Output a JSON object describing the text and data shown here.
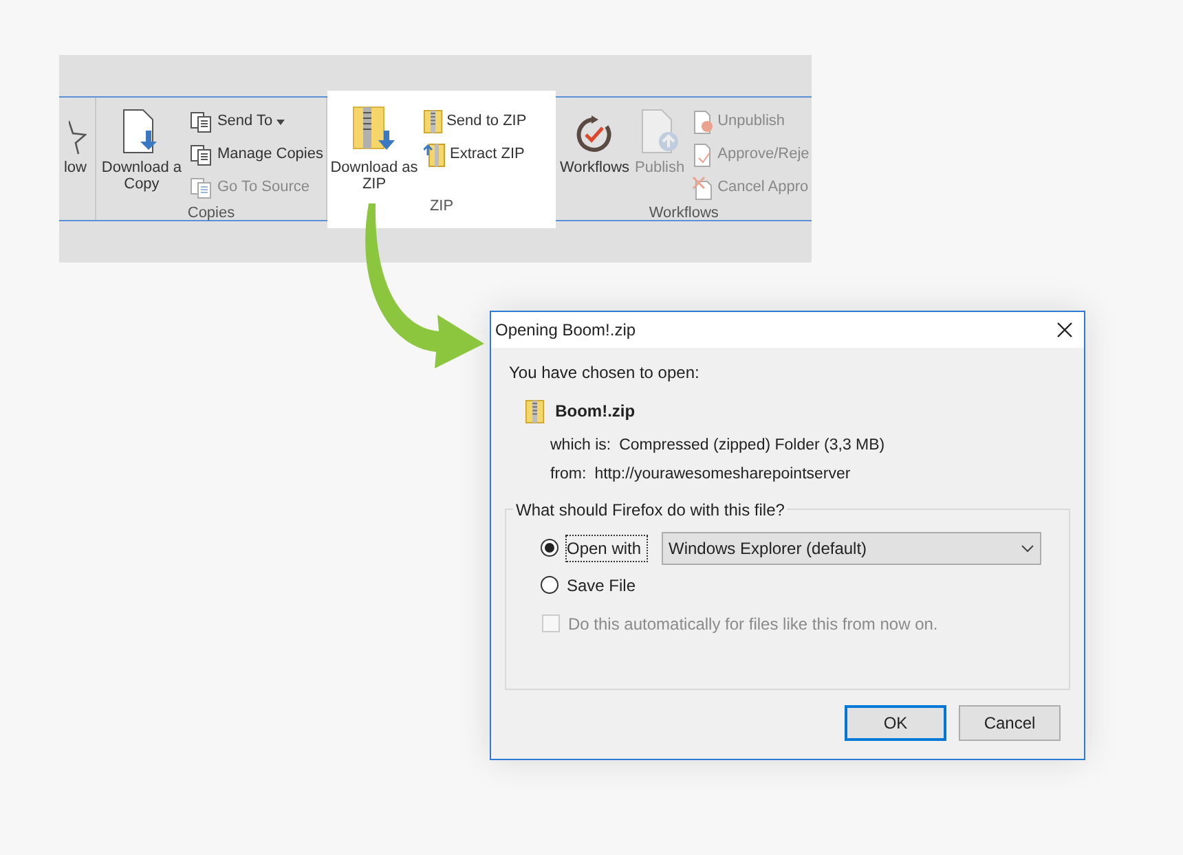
{
  "ribbon": {
    "groups": [
      {
        "highlighted": false,
        "large": [
          {
            "label": "low",
            "disabled": false
          }
        ]
      },
      {
        "label": "Copies",
        "highlighted": false,
        "large": [
          {
            "label": "Download a Copy",
            "disabled": false
          }
        ],
        "small": [
          {
            "label": "Send To",
            "dropdown": true,
            "disabled": false
          },
          {
            "label": "Manage Copies",
            "dropdown": false,
            "disabled": false
          },
          {
            "label": "Go To Source",
            "dropdown": false,
            "disabled": true
          }
        ]
      },
      {
        "label": "ZIP",
        "highlighted": true,
        "large": [
          {
            "label": "Download as ZIP",
            "disabled": false
          }
        ],
        "small": [
          {
            "label": "Send to ZIP",
            "dropdown": false,
            "disabled": false
          },
          {
            "label": "Extract ZIP",
            "dropdown": false,
            "disabled": false
          }
        ]
      },
      {
        "label": "Workflows",
        "highlighted": false,
        "large": [
          {
            "label": "Workflows",
            "disabled": false
          },
          {
            "label": "Publish",
            "disabled": true
          }
        ],
        "small": [
          {
            "label": "Unpublish",
            "dropdown": false,
            "disabled": true
          },
          {
            "label": "Approve/Reje",
            "dropdown": false,
            "disabled": true
          },
          {
            "label": "Cancel Appro",
            "dropdown": false,
            "disabled": true
          }
        ]
      }
    ]
  },
  "dialog": {
    "title": "Opening Boom!.zip",
    "intro": "You have chosen to open:",
    "file": {
      "name": "Boom!.zip",
      "which_is_label": "which is:",
      "which_is": "Compressed (zipped) Folder (3,3 MB)",
      "from_label": "from:",
      "from": "http://yourawesomesharepointserver"
    },
    "question": "What should Firefox do with this file?",
    "options": [
      {
        "label": "Open with",
        "selected": true,
        "focused": true,
        "select_value": "Windows Explorer (default)"
      },
      {
        "label": "Save File",
        "selected": false,
        "focused": false
      }
    ],
    "auto_checkbox": {
      "label": "Do this automatically for files like this from now on.",
      "checked": false,
      "disabled": true
    },
    "buttons": [
      {
        "label": "OK",
        "default": true
      },
      {
        "label": "Cancel",
        "default": false
      }
    ]
  }
}
